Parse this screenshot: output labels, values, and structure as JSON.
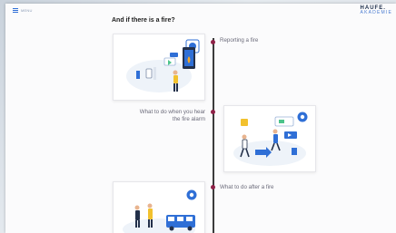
{
  "header": {
    "menu_label": "MENU",
    "logo_line1": "HAUFE.",
    "logo_line2": "AKADEMIE"
  },
  "page": {
    "title": "And if there is a fire?"
  },
  "steps": [
    {
      "label": "Reporting a fire"
    },
    {
      "label_line1": "What to do when you hear",
      "label_line2": "the fire alarm"
    },
    {
      "label": "What to do after a fire"
    }
  ],
  "colors": {
    "accent": "#2f6fd6",
    "timeline_dot": "#8e2147",
    "timeline": "#3b3b3b"
  }
}
